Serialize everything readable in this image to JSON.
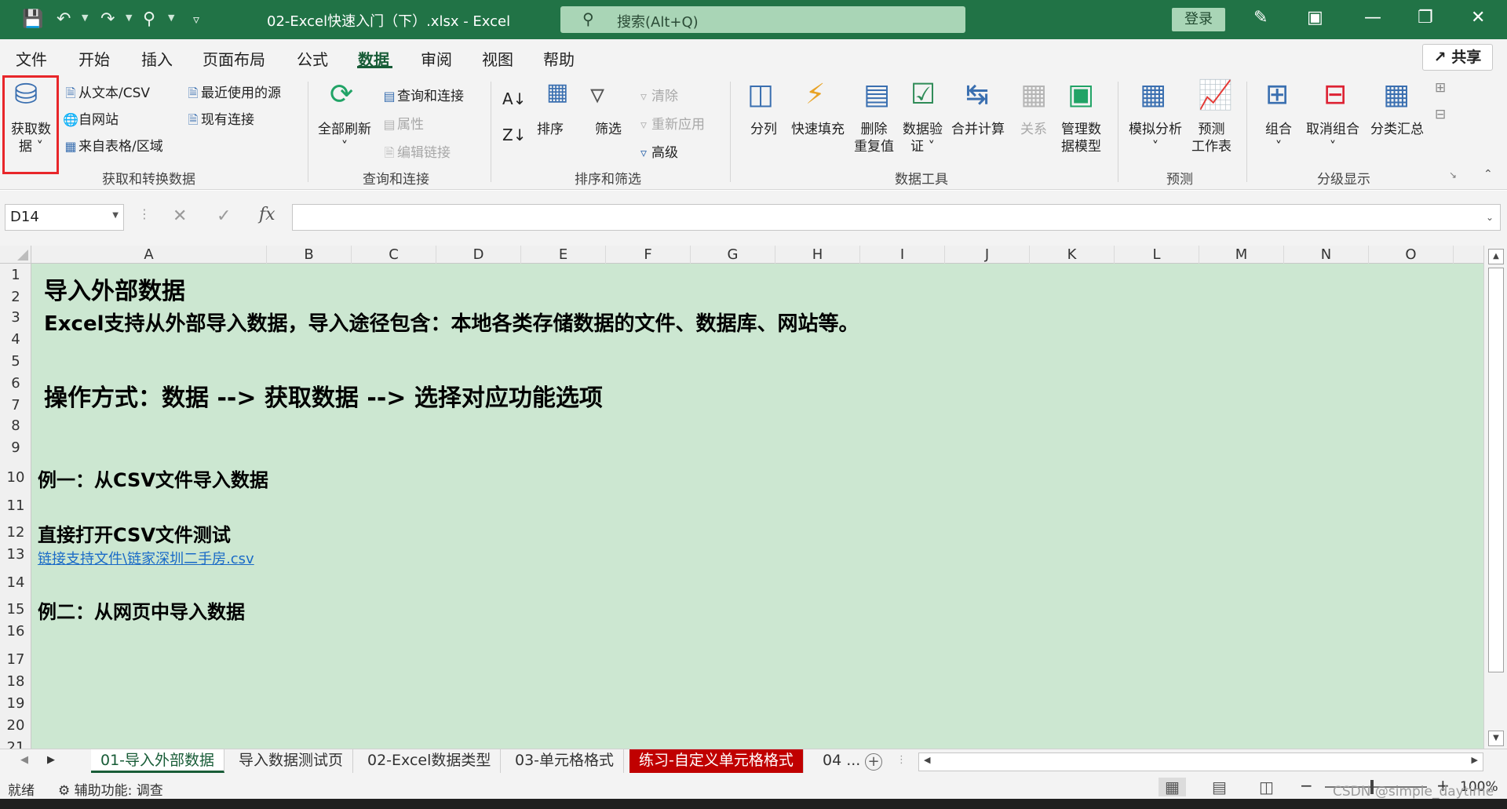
{
  "titlebar": {
    "file_title": "02-Excel快速入门（下）.xlsx  -  Excel",
    "search_placeholder": "搜索(Alt+Q)",
    "login": "登录"
  },
  "menu": {
    "tabs": [
      "文件",
      "开始",
      "插入",
      "页面布局",
      "公式",
      "数据",
      "审阅",
      "视图",
      "帮助"
    ],
    "active": "数据",
    "share": "共享"
  },
  "ribbon": {
    "get_data": "获取数",
    "get_data_line2": "据",
    "from_text_csv": "从文本/CSV",
    "from_web": "自网站",
    "from_table": "来自表格/区域",
    "recent_sources": "最近使用的源",
    "existing_connections": "现有连接",
    "group_get_transform": "获取和转换数据",
    "refresh_all": "全部刷新",
    "queries_connections": "查询和连接",
    "properties": "属性",
    "edit_links": "编辑链接",
    "group_queries": "查询和连接",
    "sort": "排序",
    "filter": "筛选",
    "clear": "清除",
    "reapply": "重新应用",
    "advanced": "高级",
    "group_sort_filter": "排序和筛选",
    "text_to_columns": "分列",
    "flash_fill": "快速填充",
    "remove_duplicates_1": "删除",
    "remove_duplicates_2": "重复值",
    "data_validation_1": "数据验",
    "data_validation_2": "证",
    "consolidate": "合并计算",
    "relationships": "关系",
    "manage_model_1": "管理数",
    "manage_model_2": "据模型",
    "group_data_tools": "数据工具",
    "what_if_1": "模拟分析",
    "forecast_1": "预测",
    "forecast_2": "工作表",
    "group_forecast": "预测",
    "group": "组合",
    "ungroup": "取消组合",
    "subtotal": "分类汇总",
    "group_outline": "分级显示"
  },
  "formula_bar": {
    "name_box": "D14",
    "formula": "",
    "fx": "fx"
  },
  "columns": [
    "A",
    "B",
    "C",
    "D",
    "E",
    "F",
    "G",
    "H",
    "I",
    "J",
    "K",
    "L",
    "M",
    "N",
    "O"
  ],
  "rows": [
    "1",
    "2",
    "3",
    "4",
    "5",
    "6",
    "7",
    "8",
    "9",
    "10",
    "11",
    "12",
    "13",
    "14",
    "15",
    "16",
    "17",
    "18",
    "19",
    "20",
    "21"
  ],
  "cells": {
    "r1": "导入外部数据",
    "r3": "Excel支持从外部导入数据，导入途径包含：本地各类存储数据的文件、数据库、网站等。",
    "r6": "操作方式：数据 --> 获取数据 --> 选择对应功能选项",
    "r10": "例一：从CSV文件导入数据",
    "r12": "直接打开CSV文件测试",
    "r13": "链接支持文件\\链家深圳二手房.csv",
    "r15": "例二：从网页中导入数据"
  },
  "sheet_tabs": [
    "01-导入外部数据",
    "导入数据测试页",
    "02-Excel数据类型",
    "03-单元格格式",
    "练习-自定义单元格格式",
    "04 ..."
  ],
  "status": {
    "ready": "就绪",
    "accessibility": "辅助功能: 调查",
    "zoom": "100%",
    "watermark": "CSDN @simple_daytime"
  },
  "colors": {
    "excel_green": "#217346",
    "sheet_bg": "#cce7d1",
    "highlight_box": "#e8262a",
    "red_tab": "#c00000"
  }
}
